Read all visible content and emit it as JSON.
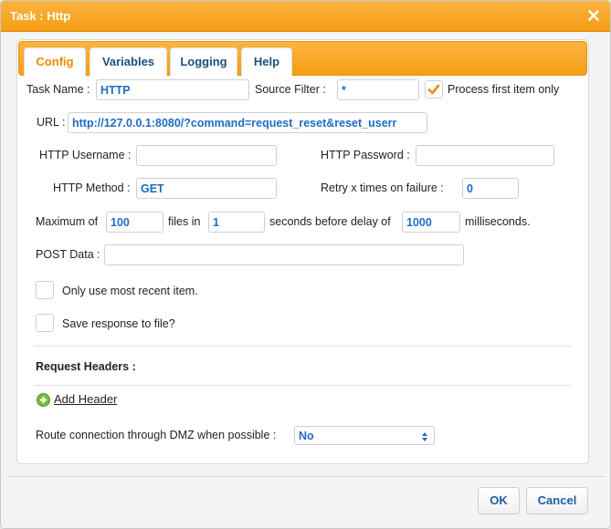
{
  "window": {
    "title": "Task : Http"
  },
  "tabs": [
    {
      "label": "Config"
    },
    {
      "label": "Variables"
    },
    {
      "label": "Logging"
    },
    {
      "label": "Help"
    }
  ],
  "form": {
    "task_name_label": "Task Name :",
    "task_name_value": "HTTP",
    "source_filter_label": "Source Filter :",
    "source_filter_value": "*",
    "process_first_label": "Process first item only",
    "process_first_checked": true,
    "url_label": "URL :",
    "url_value": "http://127.0.0.1:8080/?command=request_reset&reset_userr",
    "http_username_label": "HTTP Username :",
    "http_username_value": "",
    "http_password_label": "HTTP Password :",
    "http_password_value": "",
    "http_method_label": "HTTP Method :",
    "http_method_value": "GET",
    "retry_label": "Retry x times on failure :",
    "retry_value": "0",
    "max_label": "Maximum of",
    "max_value": "100",
    "files_in_label": "files in",
    "files_in_value": "1",
    "seconds_label": "seconds before delay of",
    "delay_value": "1000",
    "ms_label": "milliseconds.",
    "post_data_label": "POST Data :",
    "post_data_value": "",
    "most_recent_label": "Only use most recent item.",
    "save_response_label": "Save response to file?",
    "request_headers_label": "Request Headers :",
    "add_header_label": "Add Header",
    "dmz_label": "Route connection through DMZ when possible :",
    "dmz_value": "No"
  },
  "buttons": {
    "ok": "OK",
    "cancel": "Cancel"
  },
  "colors": {
    "accent": "#f59d16",
    "link": "#1d5fa6",
    "value": "#1f6cc2",
    "check": "#f08a00"
  }
}
